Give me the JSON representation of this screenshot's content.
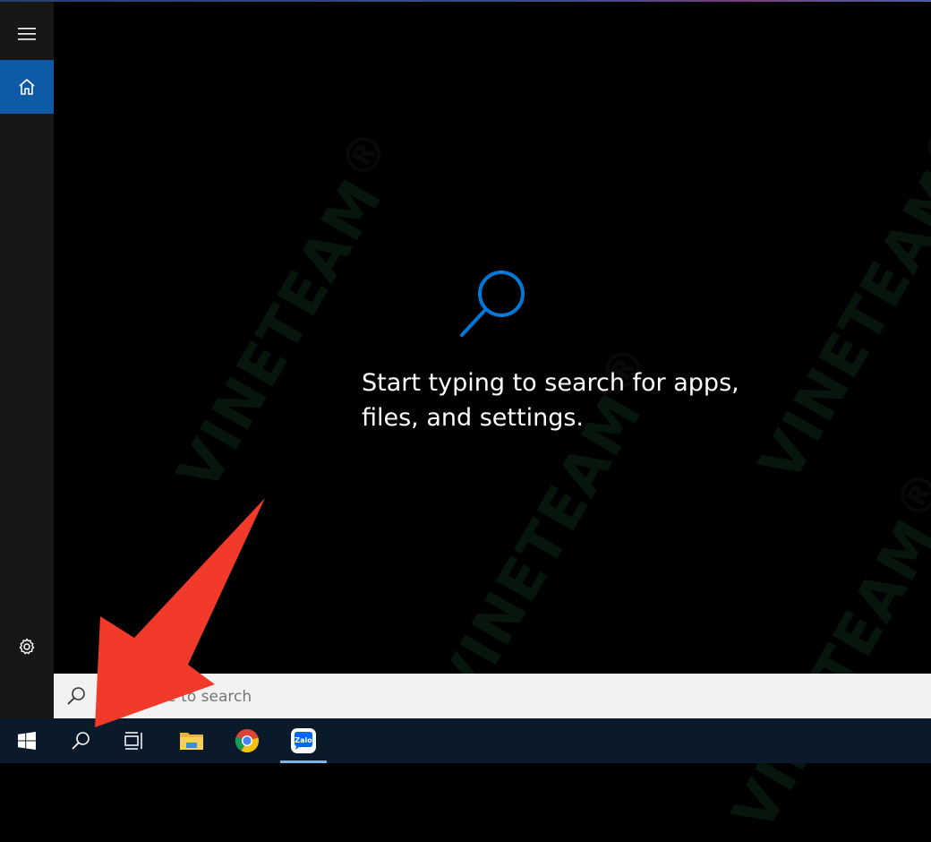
{
  "search": {
    "hero_text": "Start typing to search for apps, files, and settings.",
    "placeholder": "Type here to search"
  },
  "sidebar": {
    "items": [
      {
        "icon": "hamburger-menu-icon"
      },
      {
        "icon": "home-icon",
        "selected": true
      },
      {
        "icon": "gear-icon"
      }
    ]
  },
  "taskbar": {
    "items": [
      {
        "icon": "windows-start-icon"
      },
      {
        "icon": "search-icon"
      },
      {
        "icon": "task-view-icon"
      },
      {
        "icon": "file-explorer-icon"
      },
      {
        "icon": "chrome-icon"
      },
      {
        "icon": "zalo-icon",
        "label": "Zalo",
        "active": true
      }
    ]
  },
  "watermark": {
    "text": "VINETEAM",
    "registered": "®"
  },
  "colors": {
    "accent": "#0e5aa6",
    "search_icon": "#0078d7",
    "annotation_arrow": "#f23a2a",
    "taskbar": "#0b1a2a"
  }
}
